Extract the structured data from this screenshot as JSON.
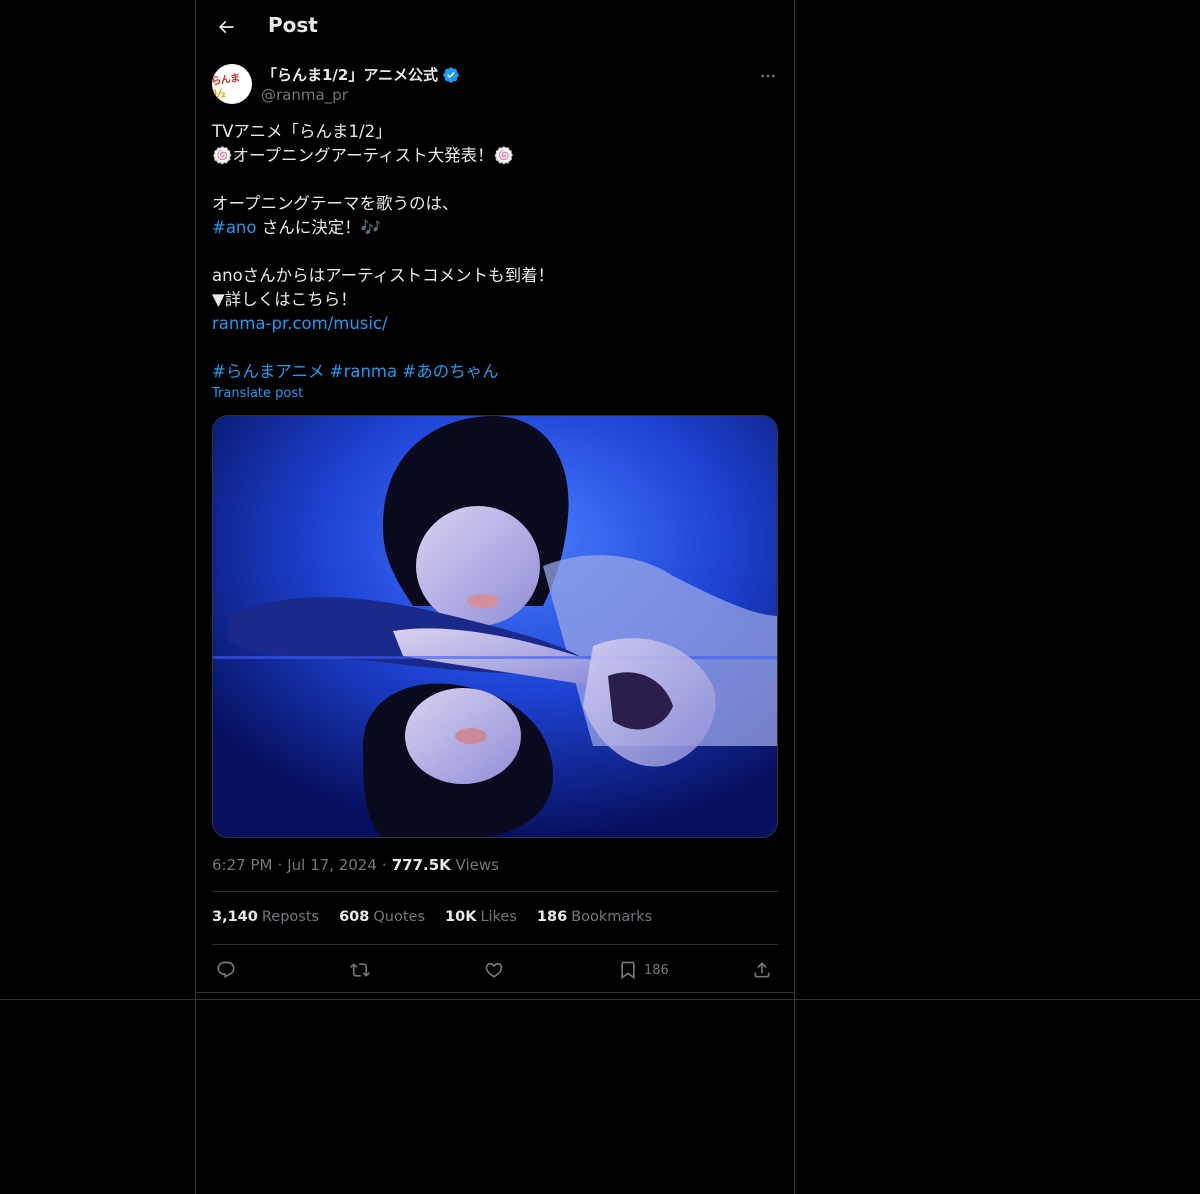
{
  "header": {
    "title": "Post"
  },
  "author": {
    "display_name": "「らんま1/2」アニメ公式",
    "handle": "@ranma_pr",
    "avatar_text": "らんま",
    "avatar_num": "½"
  },
  "tweet": {
    "line1": "TVアニメ「らんま1/2」",
    "line2": "🍥オープニングアーティスト大発表！🍥",
    "line3": "オープニングテーマを歌うのは、",
    "line4_tag": "#ano",
    "line4_rest": " さんに決定！🎶",
    "line5": "anoさんからはアーティストコメントも到着！",
    "line6": "▼詳しくはこちら！",
    "link": "ranma-pr.com/music/",
    "hashtags": [
      "#らんまアニメ",
      "#ranma",
      "#あのちゃん"
    ],
    "translate": "Translate post"
  },
  "meta": {
    "time": "6:27 PM",
    "sep1": "·",
    "date": "Jul 17, 2024",
    "sep2": "·",
    "views_num": "777.5K",
    "views_label": "Views"
  },
  "stats": {
    "reposts_num": "3,140",
    "reposts_label": "Reposts",
    "quotes_num": "608",
    "quotes_label": "Quotes",
    "likes_num": "10K",
    "likes_label": "Likes",
    "bookmarks_num": "186",
    "bookmarks_label": "Bookmarks"
  },
  "actions": {
    "bookmark_count": "186"
  },
  "colors": {
    "accent": "#1d9bf0",
    "background": "#000000",
    "border": "#2f3336",
    "muted": "#71767b",
    "text": "#e7e9ea"
  }
}
